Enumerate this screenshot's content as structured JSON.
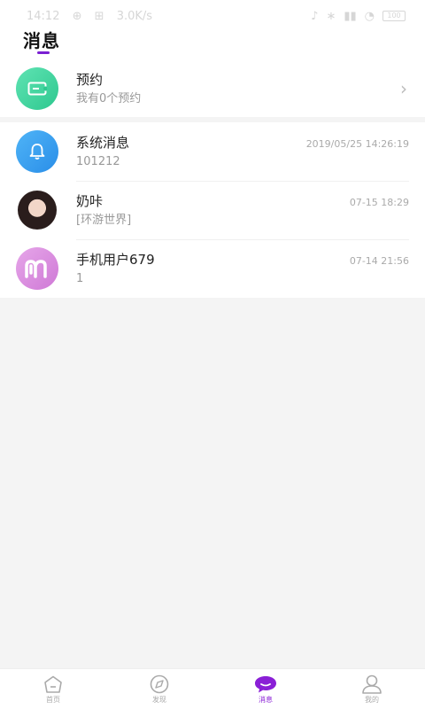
{
  "status_bar": {
    "time": "14:12",
    "net_speed": "3.0K/s",
    "battery": "100"
  },
  "page_title": "消息",
  "appointment": {
    "title": "预约",
    "subtitle": "我有0个预约"
  },
  "messages": [
    {
      "name": "系统消息",
      "preview": "101212",
      "time": "2019/05/25 14:26:19",
      "avatar": "bell-icon"
    },
    {
      "name": "奶咔",
      "preview": "[环游世界]",
      "time": "07-15 18:29",
      "avatar": "user-photo"
    },
    {
      "name": "手机用户679",
      "preview": "1",
      "time": "07-14 21:56",
      "avatar": "m-logo"
    }
  ],
  "tabs": [
    {
      "label": "首页",
      "icon": "home-icon",
      "active": false
    },
    {
      "label": "发现",
      "icon": "compass-icon",
      "active": false
    },
    {
      "label": "消息",
      "icon": "message-icon",
      "active": true
    },
    {
      "label": "我的",
      "icon": "person-icon",
      "active": false
    }
  ],
  "colors": {
    "accent": "#8a1fd6",
    "appointment_icon": "#2ec88f",
    "system_icon": "#2a8ee8",
    "user_icon": "#cf79d6"
  }
}
